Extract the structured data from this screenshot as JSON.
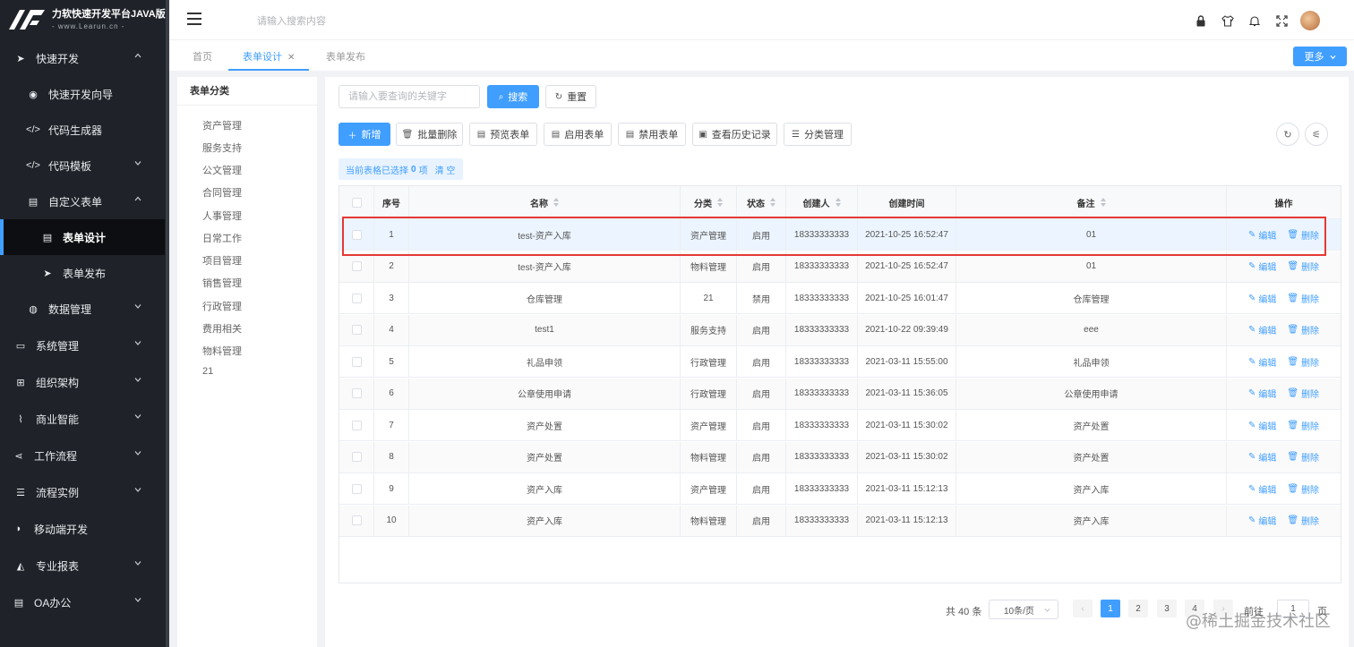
{
  "app": {
    "logo_title": "力软快速开发平台JAVA版",
    "logo_sub": "- www.Learun.cn -"
  },
  "sidebar": {
    "items": [
      {
        "label": "快速开发",
        "icon": "send-icon",
        "level": 1,
        "expanded": true
      },
      {
        "label": "快速开发向导",
        "icon": "compass-icon",
        "level": 2
      },
      {
        "label": "代码生成器",
        "icon": "code-icon",
        "level": 2
      },
      {
        "label": "代码模板",
        "icon": "code-icon",
        "level": 2,
        "expandable": true
      },
      {
        "label": "自定义表单",
        "icon": "file-icon",
        "level": 2,
        "expanded": true
      },
      {
        "label": "表单设计",
        "icon": "file-icon",
        "level": 3,
        "active": true
      },
      {
        "label": "表单发布",
        "icon": "send-icon",
        "level": 3
      },
      {
        "label": "数据管理",
        "icon": "database-icon",
        "level": 2,
        "expandable": true
      },
      {
        "label": "系统管理",
        "icon": "monitor-icon",
        "level": 1,
        "expandable": true
      },
      {
        "label": "组织架构",
        "icon": "sitemap-icon",
        "level": 1,
        "expandable": true
      },
      {
        "label": "商业智能",
        "icon": "line-chart-icon",
        "level": 1,
        "expandable": true
      },
      {
        "label": "工作流程",
        "icon": "share-icon",
        "level": 1,
        "expandable": true
      },
      {
        "label": "流程实例",
        "icon": "list-icon",
        "level": 1,
        "expandable": true
      },
      {
        "label": "移动端开发",
        "icon": "android-icon",
        "level": 1
      },
      {
        "label": "专业报表",
        "icon": "area-chart-icon",
        "level": 1,
        "expandable": true
      },
      {
        "label": "OA办公",
        "icon": "file-icon",
        "level": 1,
        "expandable": true
      }
    ]
  },
  "topbar": {
    "search_placeholder": "请输入搜索内容",
    "icons": [
      "lock-icon",
      "shirt-icon",
      "bell-icon",
      "fullscreen-icon"
    ]
  },
  "tabs": [
    {
      "label": "首页",
      "active": false
    },
    {
      "label": "表单设计",
      "active": true,
      "closable": true
    },
    {
      "label": "表单发布",
      "active": false
    }
  ],
  "more_label": "更多",
  "category_panel": {
    "title": "表单分类",
    "items": [
      "资产管理",
      "服务支持",
      "公文管理",
      "合同管理",
      "人事管理",
      "日常工作",
      "项目管理",
      "销售管理",
      "行政管理",
      "费用相关",
      "物料管理",
      "21"
    ]
  },
  "toolbar": {
    "keyword_placeholder": "请输入要查询的关键字",
    "search_label": "搜索",
    "reset_label": "重置",
    "add_label": "新增",
    "batch_delete_label": "批量删除",
    "preview_label": "预览表单",
    "enable_label": "启用表单",
    "disable_label": "禁用表单",
    "history_label": "查看历史记录",
    "category_mgmt_label": "分类管理"
  },
  "selection": {
    "prefix": "当前表格已选择",
    "count": "0",
    "suffix": "项",
    "clear_label": "清 空"
  },
  "table": {
    "columns": [
      "序号",
      "名称",
      "分类",
      "状态",
      "创建人",
      "创建时间",
      "备注",
      "操作"
    ],
    "rows": [
      {
        "no": "1",
        "name": "test-资产入库",
        "category": "资产管理",
        "status": "启用",
        "creator": "18333333333",
        "created": "2021-10-25 16:52:47",
        "remark": "01"
      },
      {
        "no": "2",
        "name": "test-资产入库",
        "category": "物料管理",
        "status": "启用",
        "creator": "18333333333",
        "created": "2021-10-25 16:52:47",
        "remark": "01"
      },
      {
        "no": "3",
        "name": "仓库管理",
        "category": "21",
        "status": "禁用",
        "creator": "18333333333",
        "created": "2021-10-25 16:01:47",
        "remark": "仓库管理"
      },
      {
        "no": "4",
        "name": "test1",
        "category": "服务支持",
        "status": "启用",
        "creator": "18333333333",
        "created": "2021-10-22 09:39:49",
        "remark": "eee"
      },
      {
        "no": "5",
        "name": "礼品申领",
        "category": "行政管理",
        "status": "启用",
        "creator": "18333333333",
        "created": "2021-03-11 15:55:00",
        "remark": "礼品申领"
      },
      {
        "no": "6",
        "name": "公章使用申请",
        "category": "行政管理",
        "status": "启用",
        "creator": "18333333333",
        "created": "2021-03-11 15:36:05",
        "remark": "公章使用申请"
      },
      {
        "no": "7",
        "name": "资产处置",
        "category": "资产管理",
        "status": "启用",
        "creator": "18333333333",
        "created": "2021-03-11 15:30:02",
        "remark": "资产处置"
      },
      {
        "no": "8",
        "name": "资产处置",
        "category": "物料管理",
        "status": "启用",
        "creator": "18333333333",
        "created": "2021-03-11 15:30:02",
        "remark": "资产处置"
      },
      {
        "no": "9",
        "name": "资产入库",
        "category": "资产管理",
        "status": "启用",
        "creator": "18333333333",
        "created": "2021-03-11 15:12:13",
        "remark": "资产入库"
      },
      {
        "no": "10",
        "name": "资产入库",
        "category": "物料管理",
        "status": "启用",
        "creator": "18333333333",
        "created": "2021-03-11 15:12:13",
        "remark": "资产入库"
      }
    ],
    "edit_label": "编辑",
    "delete_label": "删除"
  },
  "pagination": {
    "total_label": "共 40 条",
    "page_size_label": "10条/页",
    "pages": [
      "1",
      "2",
      "3",
      "4"
    ],
    "current_page": "1",
    "goto_prefix": "前往",
    "goto_value": "1",
    "goto_suffix": "页"
  },
  "watermark": "@稀土掘金技术社区",
  "colors": {
    "primary": "#409eff",
    "sidebar_bg": "#1f2329",
    "highlight_border": "#e53935"
  }
}
